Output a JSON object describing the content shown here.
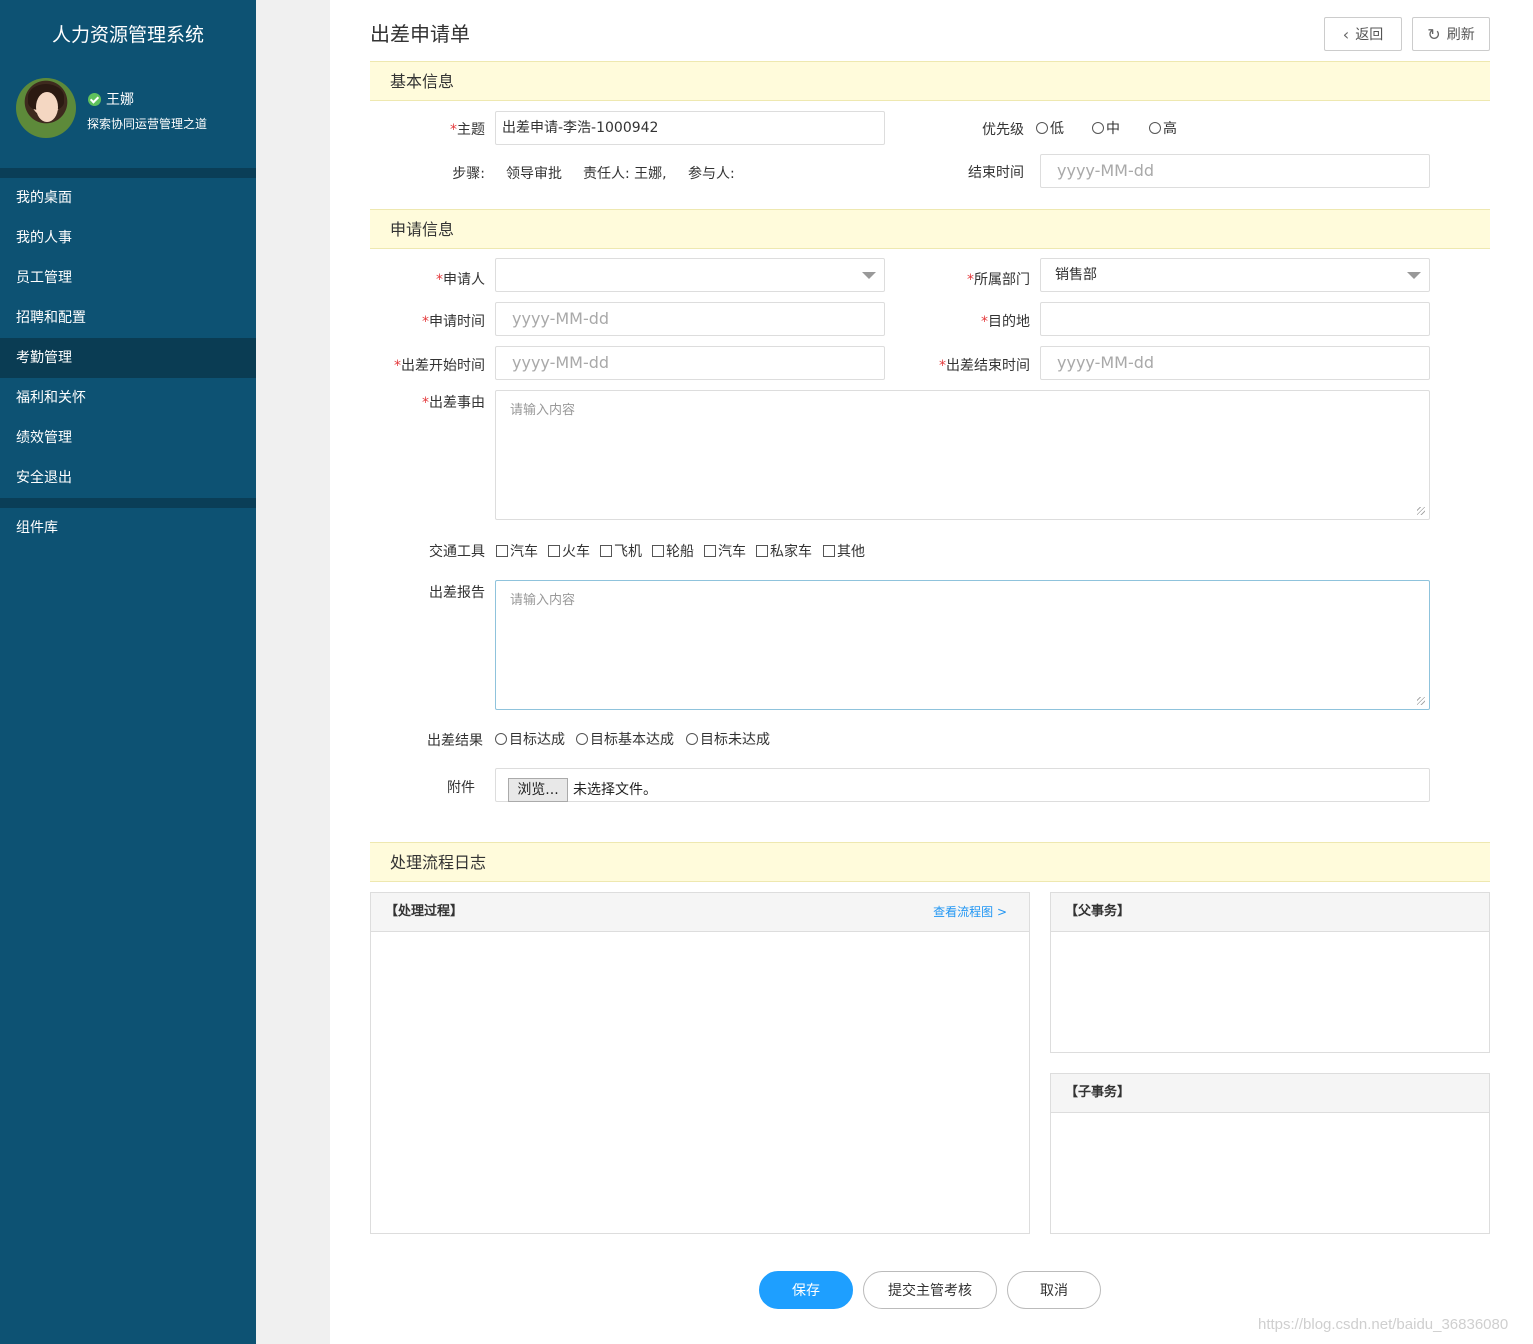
{
  "sidebar": {
    "app_title": "人力资源管理系统",
    "user_name": "王娜",
    "user_motto": "探索协同运营管理之道",
    "menu": [
      {
        "label": "我的桌面"
      },
      {
        "label": "我的人事"
      },
      {
        "label": "员工管理"
      },
      {
        "label": "招聘和配置"
      },
      {
        "label": "考勤管理",
        "active": true
      },
      {
        "label": "福利和关怀"
      },
      {
        "label": "绩效管理"
      },
      {
        "label": "安全退出"
      }
    ],
    "extra_menu": [
      {
        "label": "组件库"
      }
    ]
  },
  "header": {
    "title": "出差申请单",
    "back_label": "返回",
    "refresh_label": "刷新"
  },
  "basic": {
    "section_title": "基本信息",
    "subject_label": "主题",
    "subject_value": "出差申请-李浩-1000942",
    "priority_label": "优先级",
    "priority_options": [
      "低",
      "中",
      "高"
    ],
    "step_label": "步骤:",
    "step_value": "领导审批",
    "owner_text": "责任人: 王娜,",
    "participant_text": "参与人:",
    "end_time_label": "结束时间",
    "end_time_placeholder": "yyyy-MM-dd"
  },
  "apply": {
    "section_title": "申请信息",
    "applicant_label": "申请人",
    "applicant_value": "",
    "dept_label": "所属部门",
    "dept_value": "销售部",
    "apply_time_label": "申请时间",
    "apply_time_placeholder": "yyyy-MM-dd",
    "destination_label": "目的地",
    "destination_value": "",
    "start_label": "出差开始时间",
    "start_placeholder": "yyyy-MM-dd",
    "end_label": "出差结束时间",
    "end_placeholder": "yyyy-MM-dd",
    "reason_label": "出差事由",
    "reason_placeholder": "请输入内容",
    "transport_label": "交通工具",
    "transport_options": [
      "汽车",
      "火车",
      "飞机",
      "轮船",
      "汽车",
      "私家车",
      "其他"
    ],
    "report_label": "出差报告",
    "report_placeholder": "请输入内容",
    "result_label": "出差结果",
    "result_options": [
      "目标达成",
      "目标基本达成",
      "目标未达成"
    ],
    "attachment_label": "附件",
    "browse_label": "浏览...",
    "no_file_text": "未选择文件。"
  },
  "log": {
    "section_title": "处理流程日志",
    "process_title": "【处理过程】",
    "view_flow_link": "查看流程图 >",
    "parent_title": "【父事务】",
    "child_title": "【子事务】"
  },
  "actions": {
    "save": "保存",
    "submit": "提交主管考核",
    "cancel": "取消"
  },
  "watermark": "https://blog.csdn.net/baidu_36836080",
  "colors": {
    "sidebar_bg": "#0d5273",
    "section_bg": "#fffbdb",
    "primary": "#1e9fff",
    "required": "#e4393c"
  }
}
